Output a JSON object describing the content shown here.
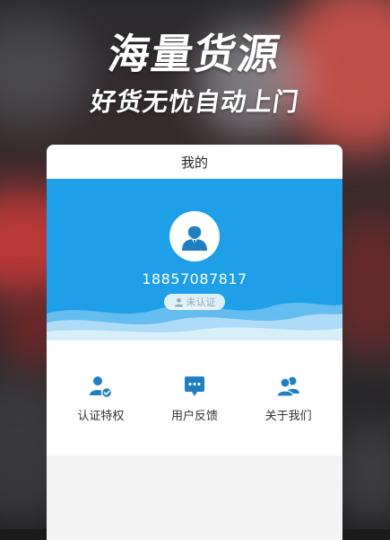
{
  "promo": {
    "headline": "海量货源",
    "subline": "好货无忧自动上门"
  },
  "screen": {
    "title": "我的",
    "profile": {
      "phone": "18857087817",
      "verify_status": "未认证"
    },
    "actions": [
      {
        "label": "认证特权",
        "icon": "user-verified-icon"
      },
      {
        "label": "用户反馈",
        "icon": "chat-bubble-icon"
      },
      {
        "label": "关于我们",
        "icon": "users-icon"
      }
    ]
  },
  "colors": {
    "accent": "#1f9fe8",
    "icon": "#1f7fc2"
  }
}
